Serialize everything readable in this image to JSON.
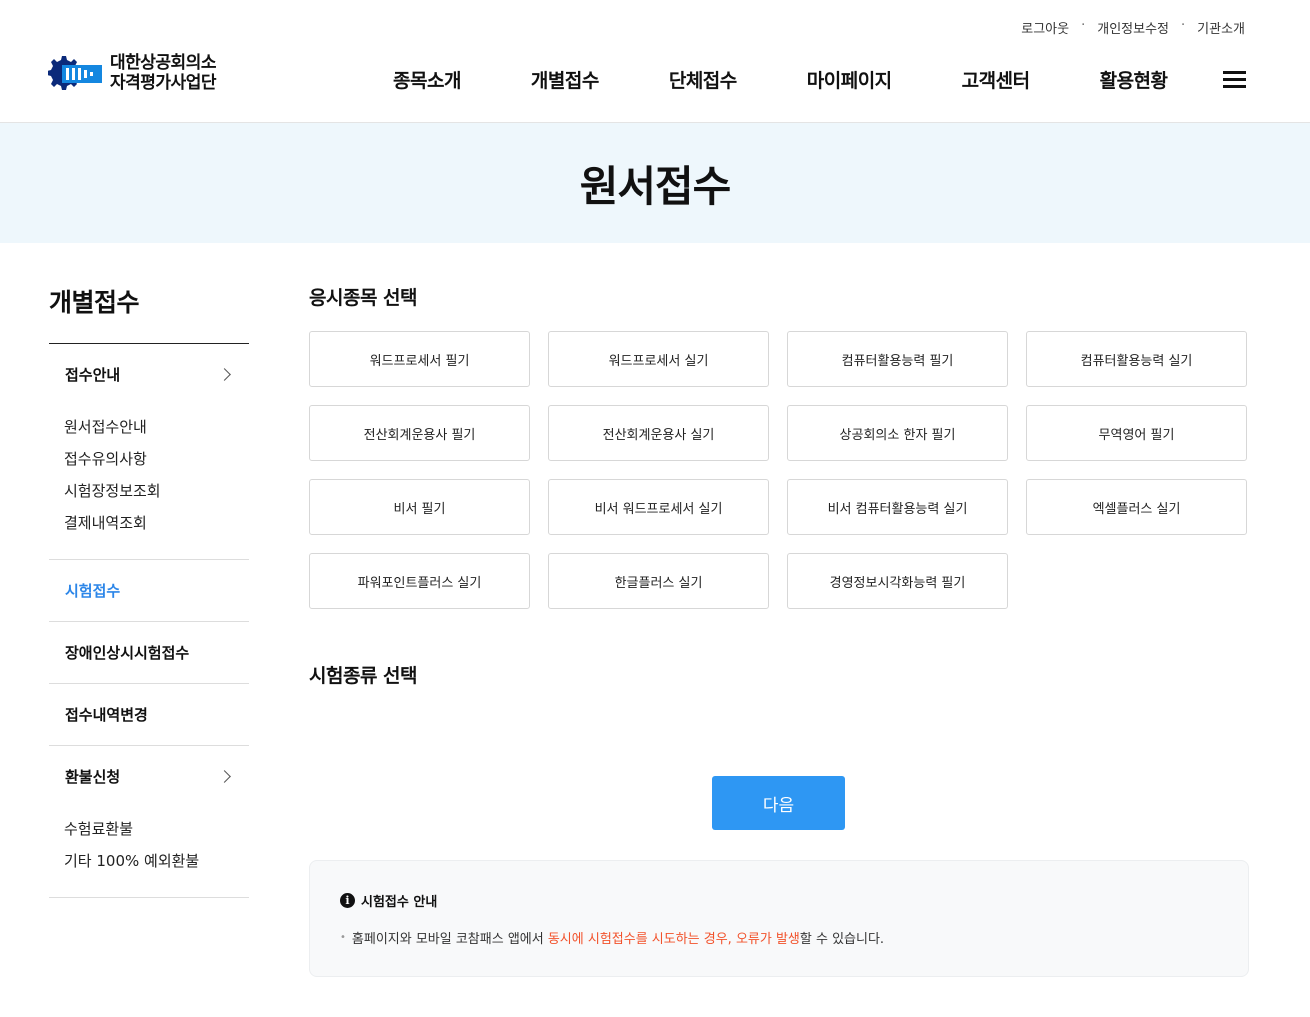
{
  "util_links": [
    "로그아웃",
    "개인정보수정",
    "기관소개"
  ],
  "util_separator": "·",
  "logo": {
    "line1": "대한상공회의소",
    "line2": "자격평가사업단"
  },
  "gnb": [
    "종목소개",
    "개별접수",
    "단체접수",
    "마이페이지",
    "고객센터",
    "활용현황"
  ],
  "page_title": "원서접수",
  "sidebar": {
    "title": "개별접수",
    "groups": [
      {
        "label": "접수안내",
        "sub": [
          "원서접수안내",
          "접수유의사항",
          "시험장정보조회",
          "결제내역조회"
        ]
      },
      {
        "label": "시험접수"
      },
      {
        "label": "장애인상시시험접수"
      },
      {
        "label": "접수내역변경"
      },
      {
        "label": "환불신청",
        "sub": [
          "수험료환불",
          "기타 100% 예외환불"
        ]
      }
    ]
  },
  "main": {
    "section1_title": "응시종목 선택",
    "subjects": [
      "워드프로세서 필기",
      "워드프로세서 실기",
      "컴퓨터활용능력 필기",
      "컴퓨터활용능력 실기",
      "전산회계운용사 필기",
      "전산회계운용사 실기",
      "상공회의소 한자 필기",
      "무역영어 필기",
      "비서 필기",
      "비서 워드프로세서 실기",
      "비서 컴퓨터활용능력 실기",
      "엑셀플러스 실기",
      "파워포인트플러스 실기",
      "한글플러스 실기",
      "경영정보시각화능력 필기"
    ],
    "section2_title": "시험종류 선택",
    "next_label": "다음"
  },
  "notice": {
    "title": "시험접수 안내",
    "icon": "i",
    "bullet": "•",
    "text_before": "홈페이지와 모바일 코참패스 앱에서 ",
    "text_highlight": "동시에 시험접수를 시도하는 경우, 오류가 발생",
    "text_after": "할 수 있습니다."
  },
  "colors": {
    "accent": "#2e97f3",
    "active_side": "#2c86e8",
    "banner_bg": "#eef7fc",
    "highlight": "#f2522b"
  }
}
